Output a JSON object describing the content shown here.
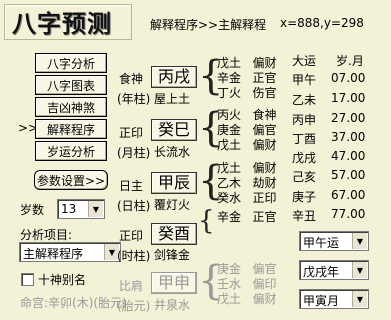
{
  "title": "八字预测",
  "header": {
    "breadcrumb": "解释程序>>主解释程",
    "coords": "x=888,y=298"
  },
  "menu": {
    "arrow": ">>",
    "buttons": [
      "八字分析",
      "八字图表",
      "吉凶神煞",
      "解释程序",
      "岁运分析"
    ],
    "settings": "参数设置>>"
  },
  "age": {
    "label": "岁数",
    "value": "13"
  },
  "analysis": {
    "label": "分析项目:",
    "value": "主解释程序"
  },
  "checkbox": {
    "label": "十神别名"
  },
  "mingong": "命宫:辛卯(木)(胎元)",
  "pillars": [
    {
      "shishen": "食神",
      "zhu": "(年柱)",
      "gz": "丙戌",
      "nayin": "屋上土",
      "hidden": [
        [
          "戊土",
          "偏财"
        ],
        [
          "辛金",
          "正官"
        ],
        [
          "丁火",
          "伤官"
        ]
      ]
    },
    {
      "shishen": "正印",
      "zhu": "(月柱)",
      "gz": "癸巳",
      "nayin": "长流水",
      "hidden": [
        [
          "丙火",
          "食神"
        ],
        [
          "庚金",
          "偏官"
        ],
        [
          "戊土",
          "偏财"
        ]
      ]
    },
    {
      "shishen": "日主",
      "zhu": "(日柱)",
      "gz": "甲辰",
      "nayin": "覆灯火",
      "hidden": [
        [
          "戊土",
          "偏财"
        ],
        [
          "乙木",
          "劫财"
        ],
        [
          "癸水",
          "正印"
        ]
      ]
    },
    {
      "shishen": "正印",
      "zhu": "(时柱)",
      "gz": "癸酉",
      "nayin": "剑锋金",
      "hidden": [
        [
          "辛金",
          "正官"
        ]
      ]
    },
    {
      "shishen": "比肩",
      "zhu": "(胎元)",
      "gz": "甲申",
      "nayin": "井泉水",
      "hidden": [
        [
          "庚金",
          "偏官"
        ],
        [
          "壬水",
          "偏印"
        ],
        [
          "戊土",
          "偏财"
        ]
      ]
    }
  ],
  "dayun": {
    "header_dy": "大运",
    "header_age": "岁.月",
    "rows": [
      [
        "甲午",
        "07.00"
      ],
      [
        "乙未",
        "17.00"
      ],
      [
        "丙申",
        "27.00"
      ],
      [
        "丁酉",
        "37.00"
      ],
      [
        "戊戌",
        "47.00"
      ],
      [
        "己亥",
        "57.00"
      ],
      [
        "庚子",
        "67.00"
      ],
      [
        "辛丑",
        "77.00"
      ]
    ]
  },
  "selects": {
    "yun": "甲午运",
    "nian": "戊戌年",
    "yue": "甲寅月"
  }
}
